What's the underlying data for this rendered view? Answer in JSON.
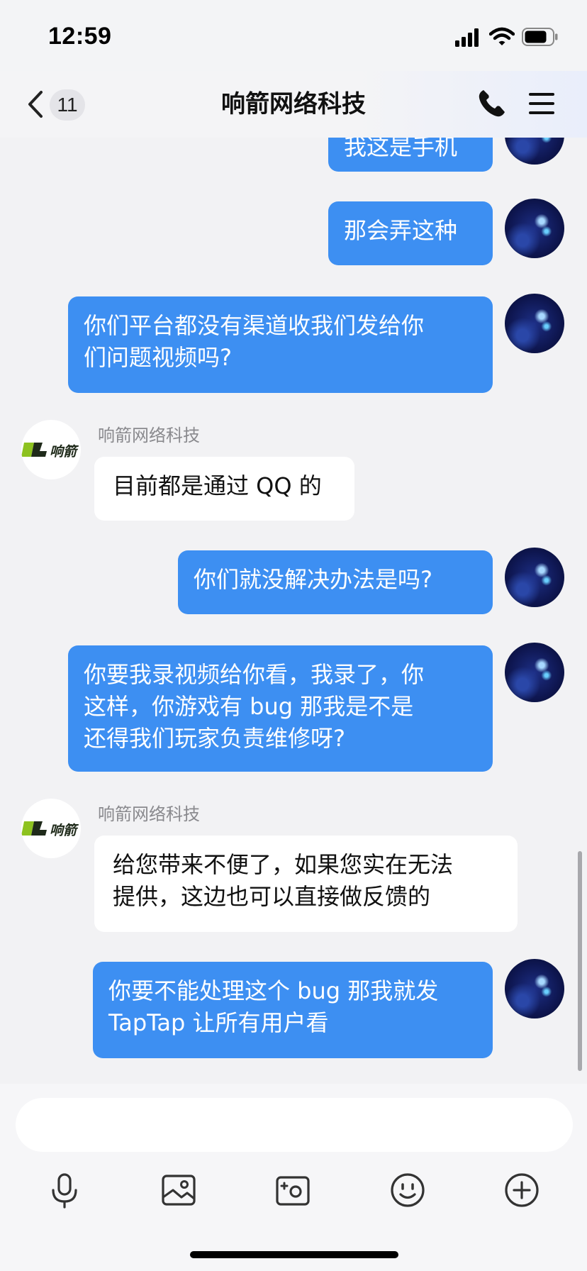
{
  "status_bar": {
    "time": "12:59"
  },
  "nav": {
    "unread_count": "11",
    "title": "响箭网络科技"
  },
  "company_logo_text": "响箭",
  "messages": [
    {
      "side": "out",
      "text": "我这是手机"
    },
    {
      "side": "out",
      "text": "那会弄这种"
    },
    {
      "side": "out",
      "line1": "你们平台都没有渠道收我们发给你",
      "line2": "们问题视频吗?"
    },
    {
      "side": "in",
      "sender": "响箭网络科技",
      "text": "目前都是通过 QQ 的"
    },
    {
      "side": "out",
      "text": "你们就没解决办法是吗?"
    },
    {
      "side": "out",
      "line1": "你要我录视频给你看，我录了，你",
      "line2": "这样，你游戏有 bug 那我是不是",
      "line3": "还得我们玩家负责维修呀?"
    },
    {
      "side": "in",
      "sender": "响箭网络科技",
      "line1": "给您带来不便了，如果您实在无法",
      "line2": "提供，这边也可以直接做反馈的"
    },
    {
      "side": "out",
      "line1": "你要不能处理这个 bug 那我就发",
      "line2": "TapTap 让所有用户看"
    }
  ],
  "input": {
    "placeholder": ""
  },
  "toolbar": [
    "microphone-icon",
    "image-icon",
    "camera-icon",
    "emoji-icon",
    "plus-icon"
  ],
  "colors": {
    "outgoing_bubble": "#3d8ff2",
    "incoming_bubble": "#ffffff",
    "background": "#f2f2f4",
    "logo_accent": "#8dc21f"
  }
}
